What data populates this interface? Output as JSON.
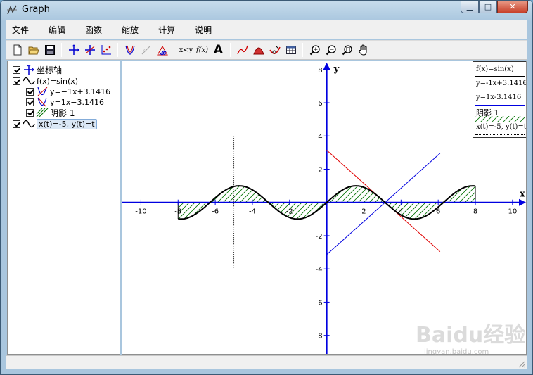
{
  "window": {
    "title": "Graph"
  },
  "menu": [
    "文件",
    "编辑",
    "函数",
    "缩放",
    "计算",
    "说明"
  ],
  "toolbar": {
    "insert_point_series_label": "x<y",
    "insert_function_label": "f(x)",
    "insert_label_label": "A"
  },
  "tree": {
    "items": [
      {
        "label": "坐标轴",
        "checked": true
      },
      {
        "label": "f(x)=sin(x)",
        "checked": true
      },
      {
        "label": "y=−1x+3.1416",
        "checked": true
      },
      {
        "label": "y=1x−3.1416",
        "checked": true
      },
      {
        "label": "阴影 1",
        "checked": true
      },
      {
        "label": "x(t)=-5, y(t)=t",
        "checked": true,
        "selected": true
      }
    ]
  },
  "legend": {
    "items": [
      "f(x)=sin(x)",
      "y=-1x+3.1416",
      "y=1x-3.1416",
      "阴影 1",
      "x(t)=-5, y(t)=t"
    ]
  },
  "axes": {
    "x_label": "x",
    "y_label": "y",
    "x_ticks": [
      -10,
      -8,
      -6,
      -4,
      -2,
      2,
      4,
      6,
      8,
      10
    ],
    "y_ticks": [
      8,
      6,
      4,
      2,
      -2,
      -4,
      -6,
      -8
    ],
    "xlim": [
      -11.0,
      10.8
    ],
    "ylim": [
      -9.2,
      8.5
    ]
  },
  "curves": {
    "function": "sin(x)",
    "shade_range": [
      -8,
      8
    ],
    "tangent1": {
      "slope": -1,
      "intercept": 3.1416,
      "range": [
        0,
        6.1
      ]
    },
    "tangent2": {
      "slope": 1,
      "intercept": -3.1416,
      "range": [
        0,
        6.1
      ]
    },
    "parametric_x": -5,
    "parametric_t_range": [
      -4,
      4
    ]
  },
  "colors": {
    "axes": "#0000e0",
    "function": "#000000",
    "tangent1": "#e00000",
    "tangent2": "#0000e0",
    "shade": "#007000"
  },
  "watermark": {
    "text": "Baidu经验",
    "sub": "jingyan.baidu.com"
  }
}
